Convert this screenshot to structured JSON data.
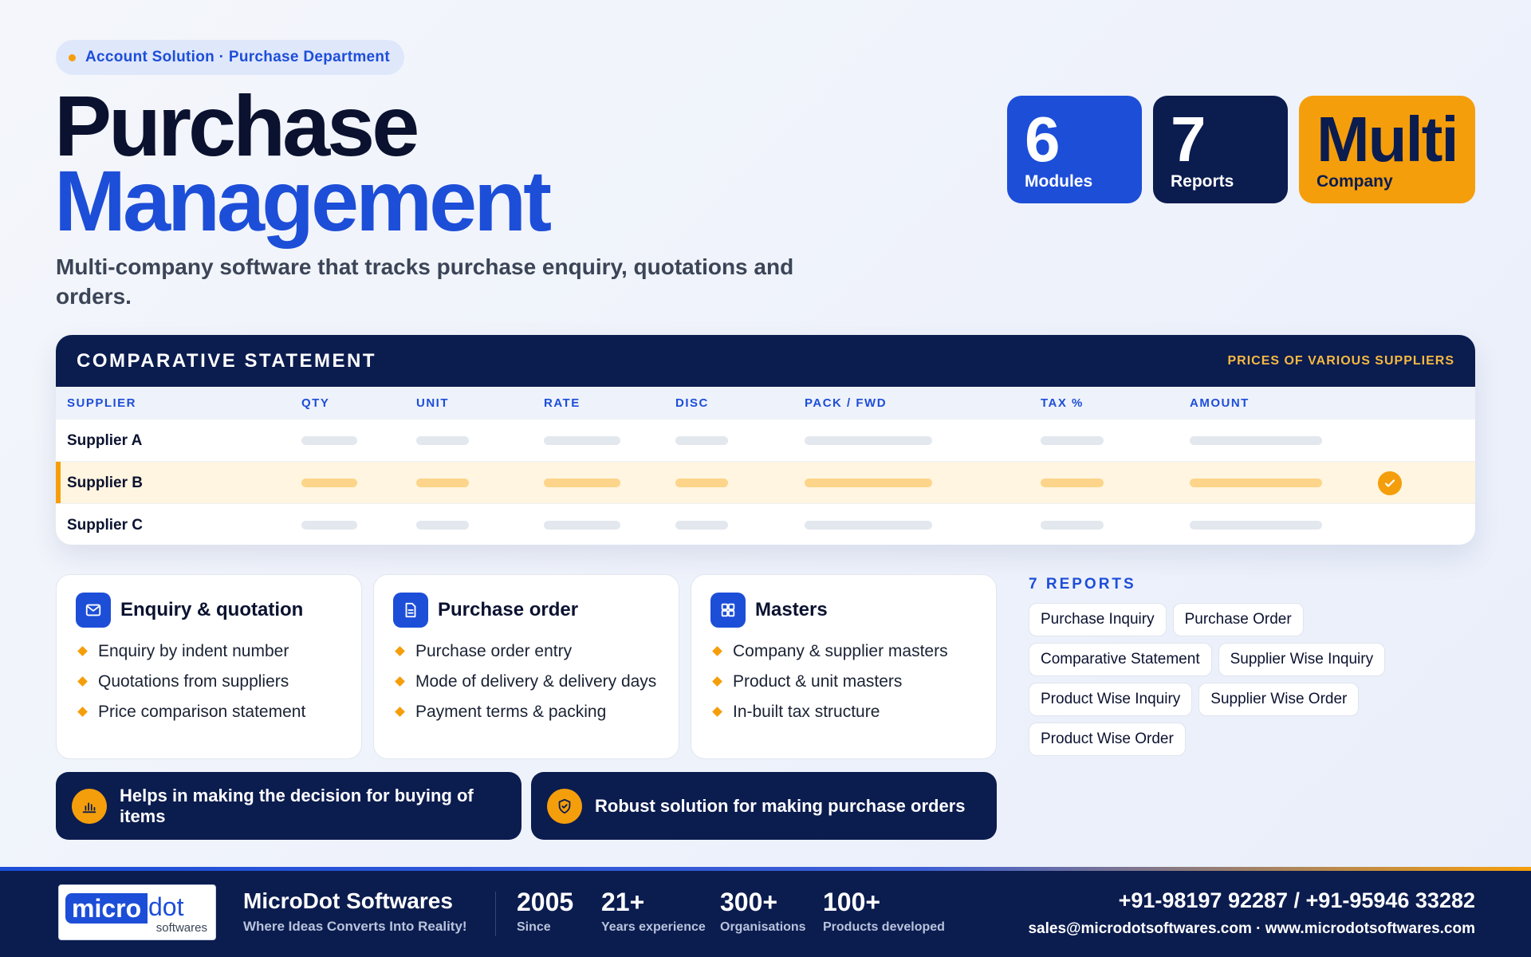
{
  "hero": {
    "breadcrumb": "Account Solution · Purchase Department",
    "title_line1": "Purchase",
    "title_line2": "Management",
    "subtitle": "Multi-company software that tracks purchase enquiry, quotations and orders."
  },
  "stats": [
    {
      "value": "6",
      "label": "Modules",
      "color": "#1d4ed8"
    },
    {
      "value": "7",
      "label": "Reports",
      "color": "#0b1c4f"
    },
    {
      "value": "Multi",
      "label": "Company",
      "color": "#f59e0b"
    }
  ],
  "comparative": {
    "title": "COMPARATIVE STATEMENT",
    "tag": "PRICES OF VARIOUS SUPPLIERS",
    "columns": [
      "SUPPLIER",
      "QTY",
      "UNIT",
      "RATE",
      "DISC",
      "PACK / FWD",
      "TAX %",
      "AMOUNT"
    ],
    "rows": [
      {
        "name": "Supplier A",
        "selected": false
      },
      {
        "name": "Supplier B",
        "selected": true
      },
      {
        "name": "Supplier C",
        "selected": false
      }
    ]
  },
  "features": [
    {
      "title": "Enquiry & quotation",
      "icon": "mail-icon",
      "items": [
        "Enquiry by indent number",
        "Quotations from suppliers",
        "Price comparison statement"
      ]
    },
    {
      "title": "Purchase order",
      "icon": "document-icon",
      "items": [
        "Purchase order entry",
        "Mode of delivery & delivery days",
        "Payment terms & packing"
      ]
    },
    {
      "title": "Masters",
      "icon": "grid-icon",
      "items": [
        "Company & supplier masters",
        "Product & unit masters",
        "In-built tax structure"
      ]
    }
  ],
  "reports": {
    "title": "7 REPORTS",
    "items": [
      "Purchase Inquiry",
      "Purchase Order",
      "Comparative Statement",
      "Supplier Wise Inquiry",
      "Product Wise Inquiry",
      "Supplier Wise Order",
      "Product Wise Order"
    ]
  },
  "benefits": [
    {
      "text": "Helps in making the decision for buying of items",
      "icon": "bar-chart-icon"
    },
    {
      "text": "Robust solution for making purchase orders",
      "icon": "shield-check-icon"
    }
  ],
  "footer": {
    "logo_main": "micro",
    "logo_dot": "dot",
    "logo_sub": "softwares",
    "company": "MicroDot Softwares",
    "tagline": "Where Ideas Converts Into Reality!",
    "stats": [
      {
        "value": "2005",
        "label": "Since"
      },
      {
        "value": "21+",
        "label": "Years experience"
      },
      {
        "value": "300+",
        "label": "Organisations"
      },
      {
        "value": "100+",
        "label": "Products developed"
      }
    ],
    "phone": "+91-98197 92287 / +91-95946 33282",
    "web": "sales@microdotsoftwares.com · www.microdotsoftwares.com"
  },
  "colors": {
    "brand_blue": "#1d4ed8",
    "navy": "#0b1c4f",
    "accent": "#f59e0b"
  }
}
